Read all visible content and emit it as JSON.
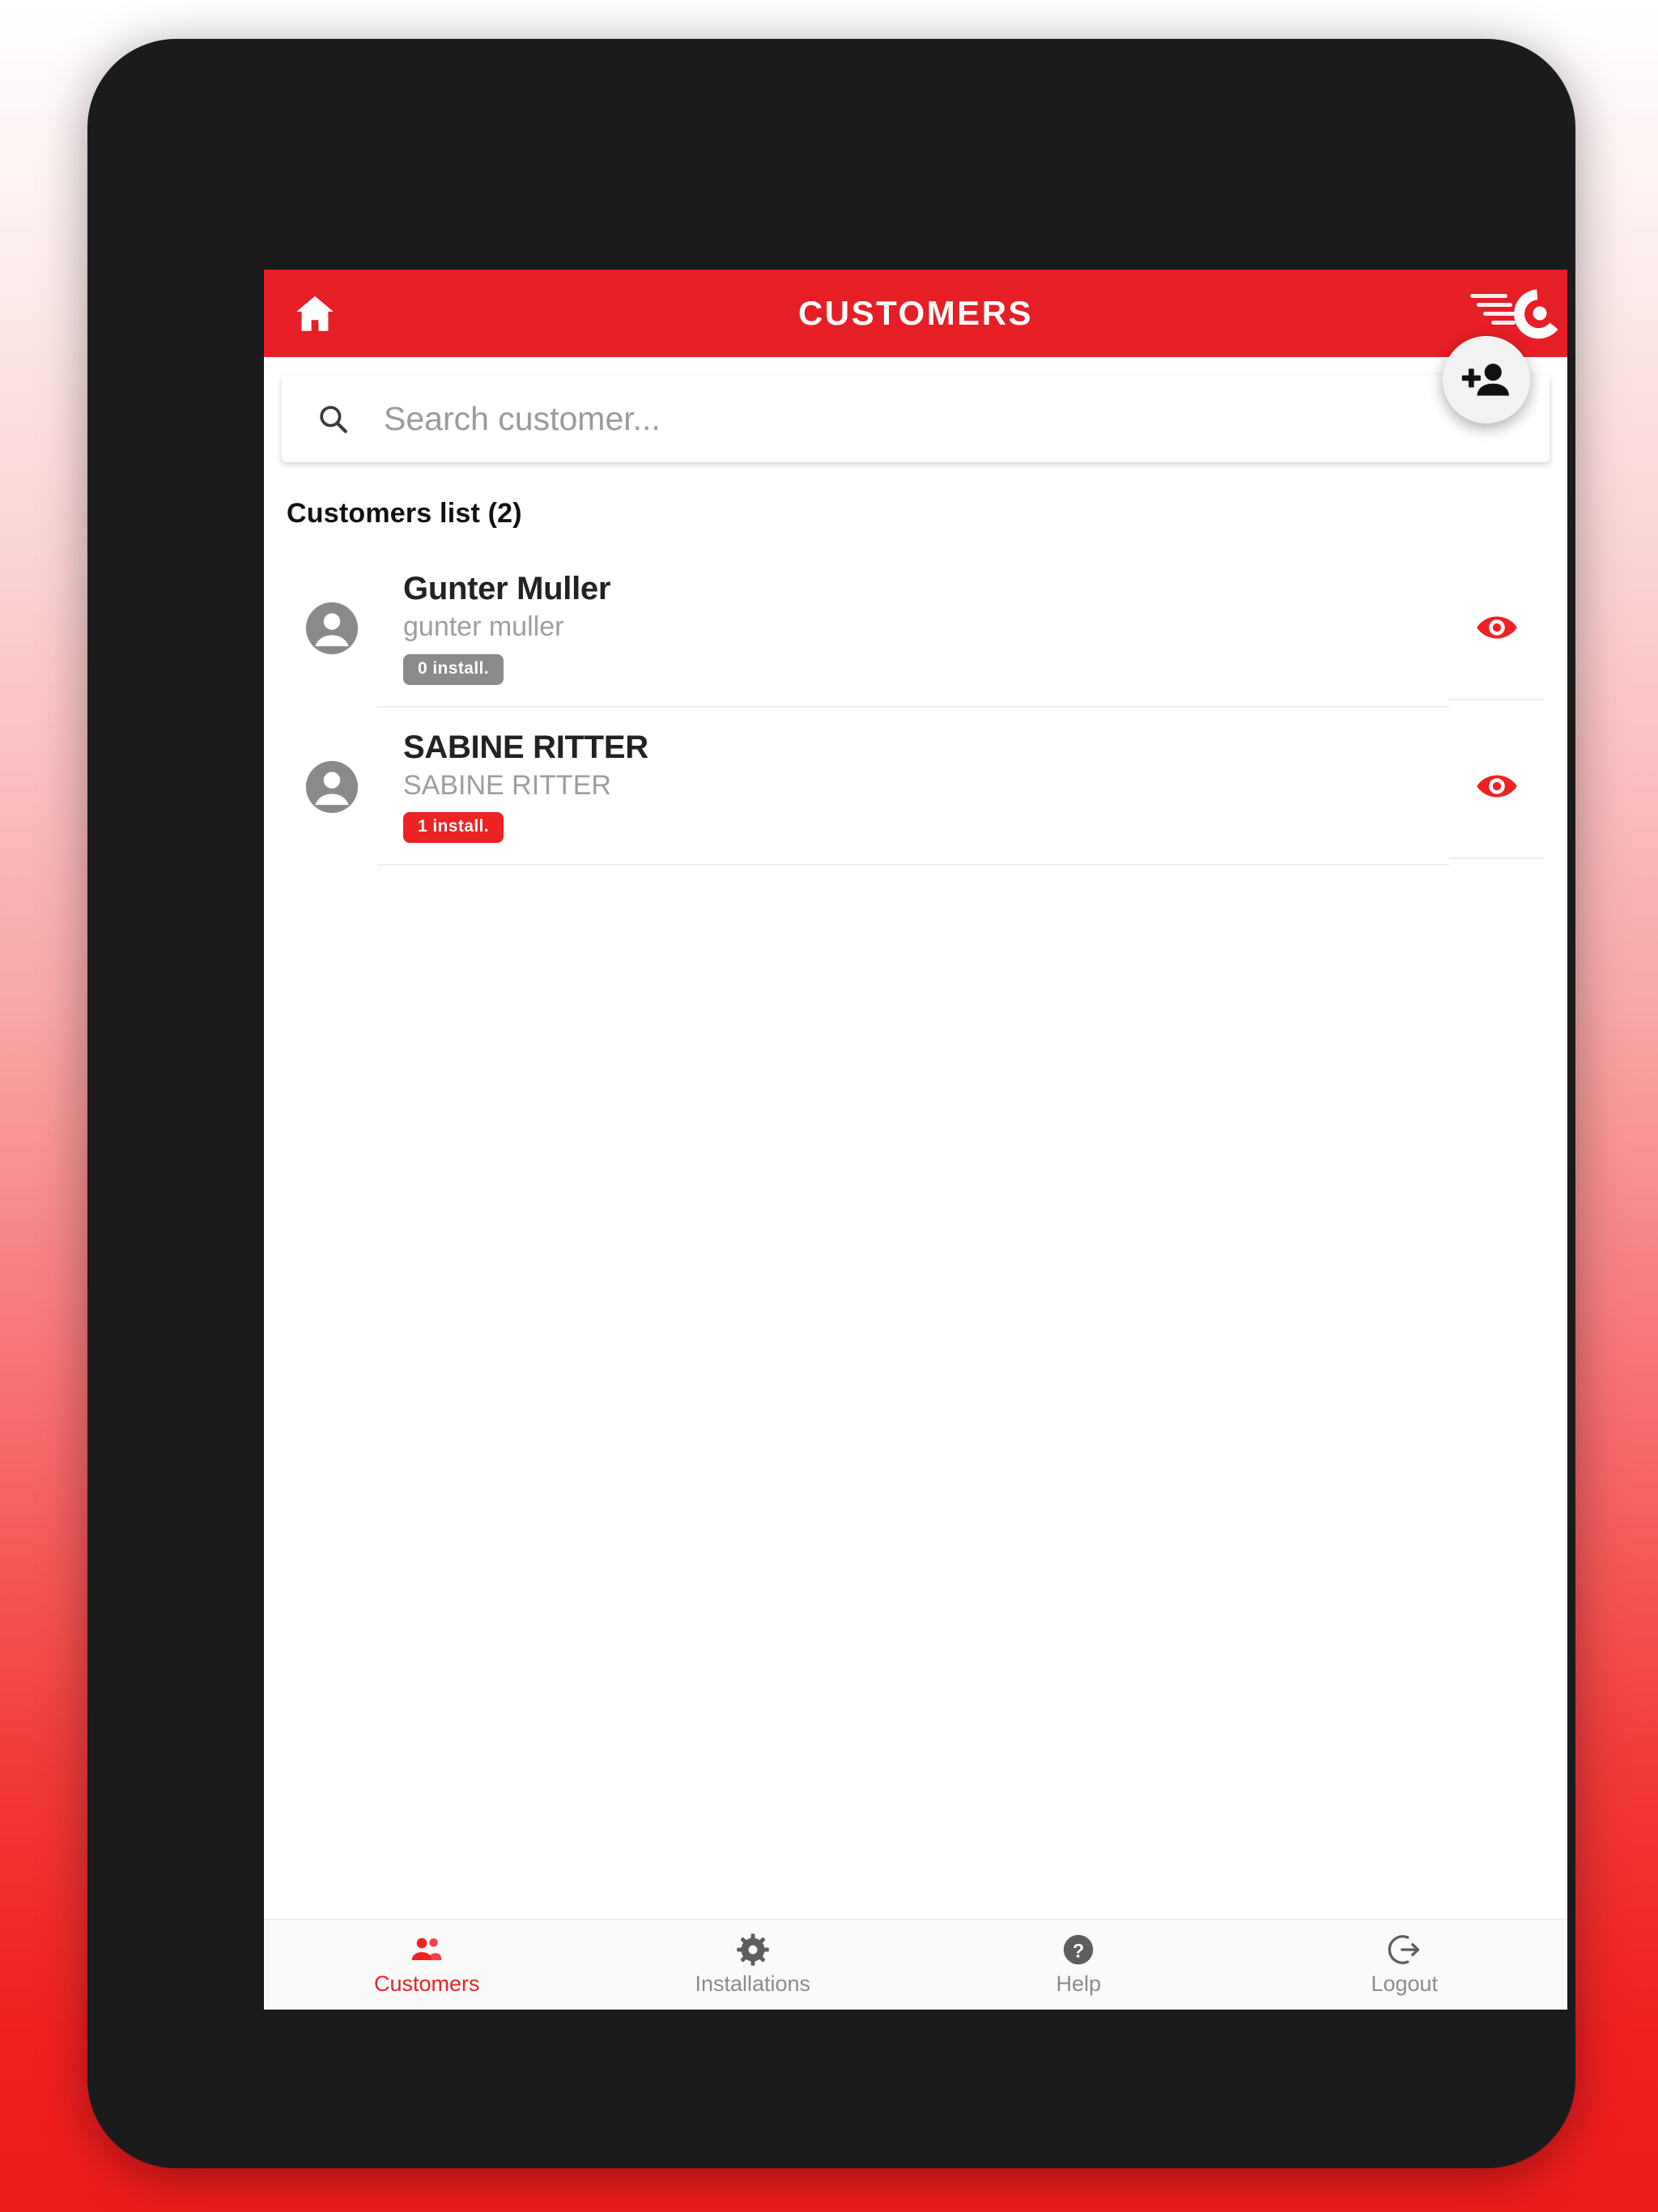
{
  "app": {
    "title": "CUSTOMERS",
    "home_icon": "home-icon",
    "brand_logo": "c-speed-logo"
  },
  "fab": {
    "label": "Add customer",
    "icon": "person-add-icon"
  },
  "search": {
    "placeholder": "Search customer...",
    "value": "",
    "icon": "search-icon"
  },
  "list": {
    "header": "Customers list (2)",
    "count": 2,
    "rows": [
      {
        "name": "Gunter Muller",
        "subtitle": "gunter muller",
        "badge": "0 install.",
        "badge_style": "gray",
        "avatar_icon": "account-circle-icon",
        "action_icon": "eye-icon"
      },
      {
        "name": "SABINE RITTER",
        "subtitle": "SABINE RITTER",
        "badge": "1 install.",
        "badge_style": "red",
        "avatar_icon": "account-circle-icon",
        "action_icon": "eye-icon"
      }
    ]
  },
  "bottom_nav": {
    "items": [
      {
        "label": "Customers",
        "icon": "people-icon",
        "active": true
      },
      {
        "label": "Installations",
        "icon": "gear-icon",
        "active": false
      },
      {
        "label": "Help",
        "icon": "help-icon",
        "active": false
      },
      {
        "label": "Logout",
        "icon": "logout-icon",
        "active": false
      }
    ]
  },
  "colors": {
    "brand_red": "#E61E26",
    "accent_red": "#EE2222",
    "badge_gray": "#8a8a8a",
    "frame_dark": "#1b1b1b",
    "muted_text": "#9e9e9e"
  }
}
